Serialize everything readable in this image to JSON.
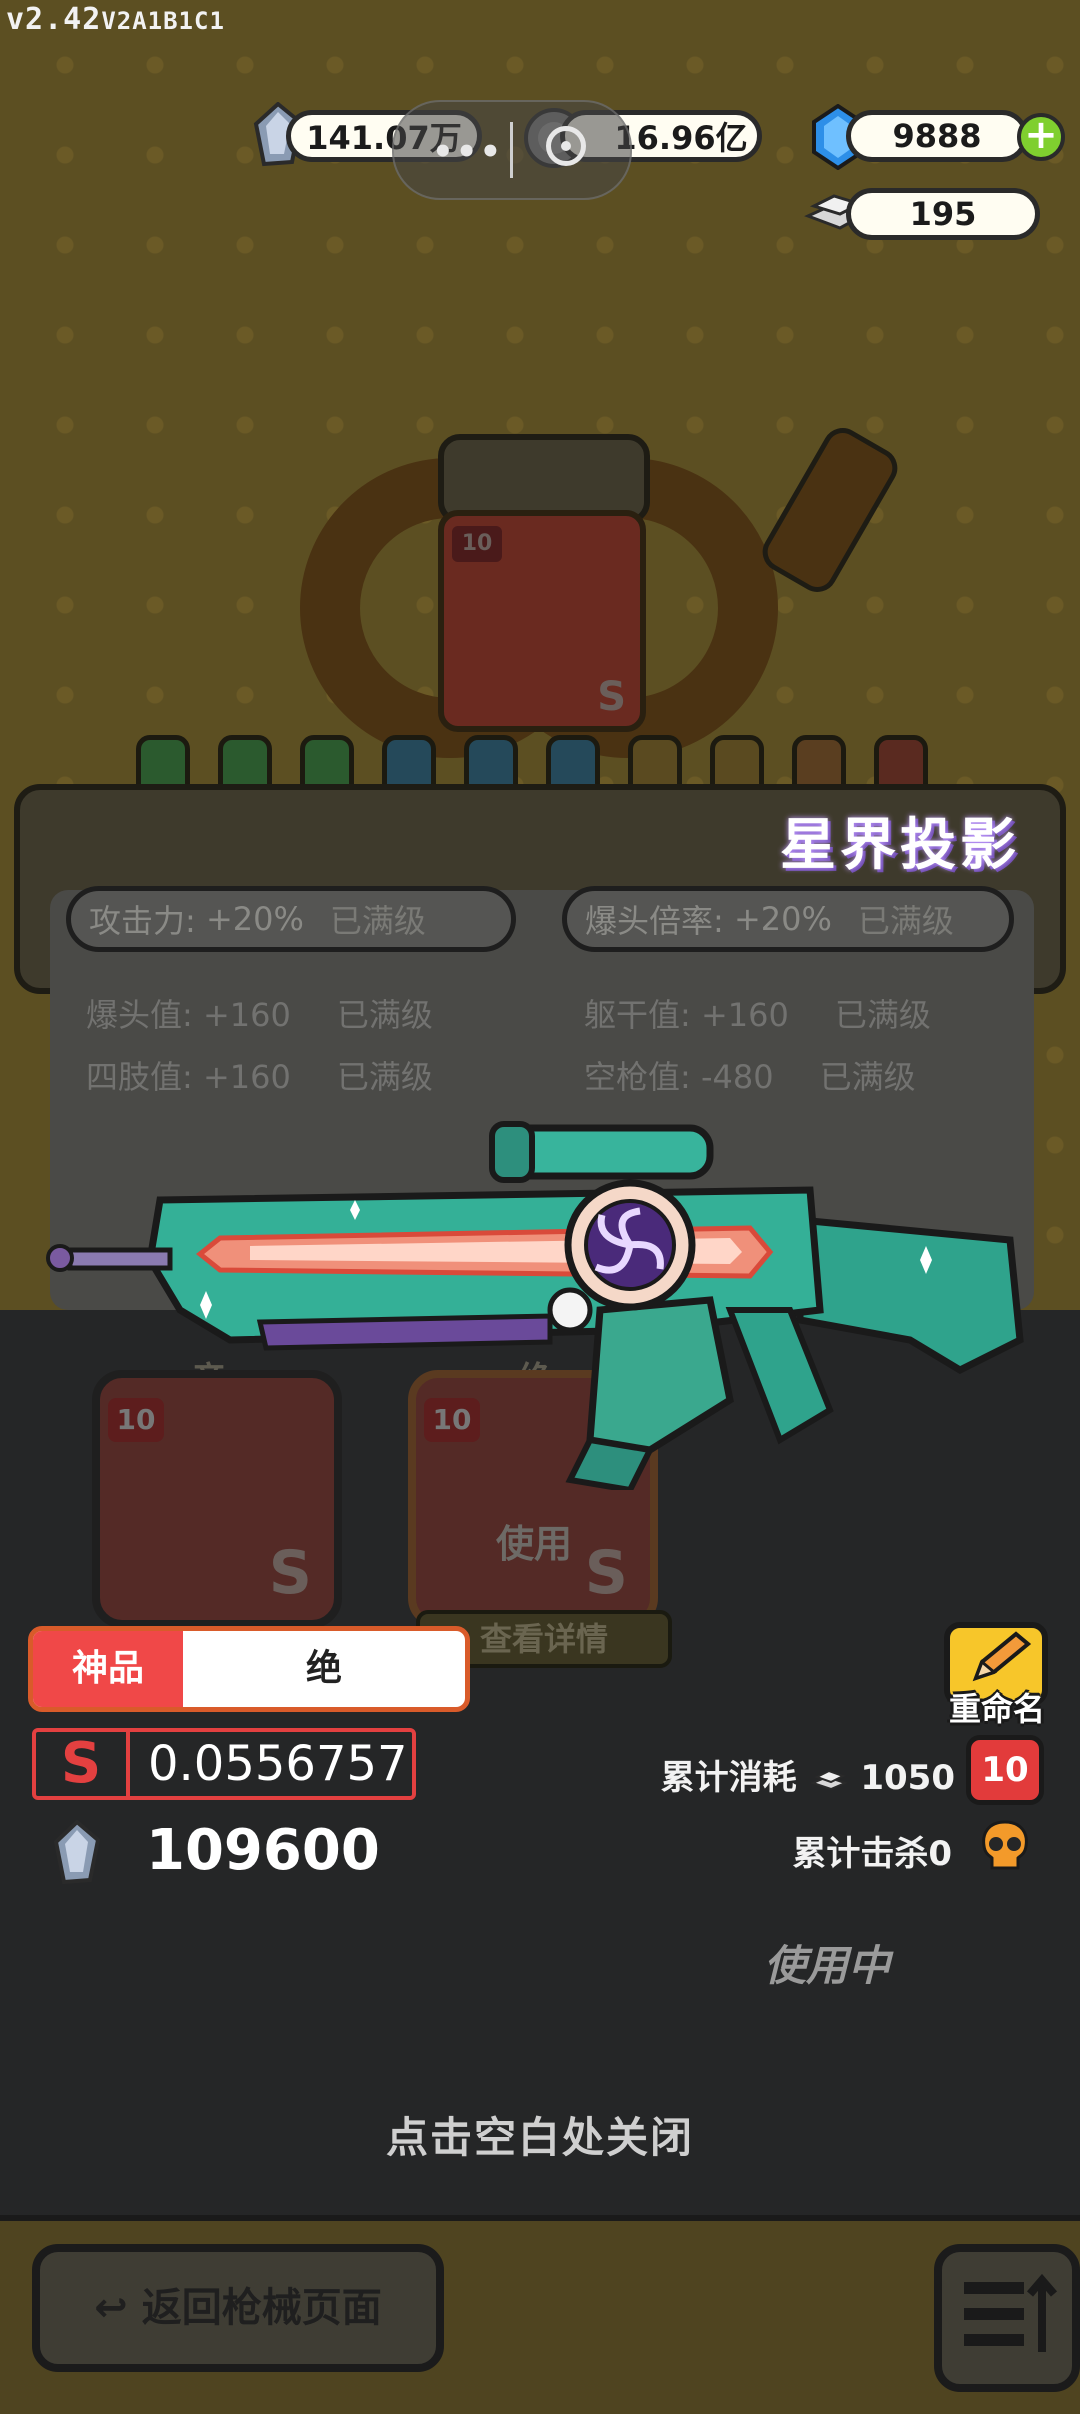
{
  "version": {
    "main": "v2.42",
    "build": "V2A1B1C1"
  },
  "currencies": {
    "crystal": "141.07万",
    "coin": "16.96亿",
    "diamond": "9888",
    "silver": "195"
  },
  "capsule": {
    "menu": "•••"
  },
  "gun": {
    "name": "星界投影",
    "quality_tag": "神品",
    "quality_value": "绝",
    "rank": "S",
    "rate": "0.0556757",
    "price": "109600",
    "in_use": "使用中"
  },
  "stats": {
    "attack": {
      "label": "攻击力:",
      "value": "+20%",
      "status": "已满级"
    },
    "headshot_rate": {
      "label": "爆头倍率:",
      "value": "+20%",
      "status": "已满级"
    },
    "rows": [
      {
        "label": "爆头值:",
        "value": "+160",
        "status": "已满级"
      },
      {
        "label": "躯干值:",
        "value": "+160",
        "status": "已满级"
      },
      {
        "label": "四肢值:",
        "value": "+160",
        "status": "已满级"
      },
      {
        "label": "空枪值:",
        "value": "-480",
        "status": "已满级"
      }
    ]
  },
  "cards": [
    {
      "tag": "帝",
      "level": "10",
      "rank": "S"
    },
    {
      "tag": "绝",
      "level": "10",
      "rank": "S",
      "used": "使用"
    }
  ],
  "card_level_badge": "10",
  "view_details": "查看详情",
  "rename": "重命名",
  "consumption": {
    "label": "累计消耗",
    "value": "1050",
    "level": "10"
  },
  "kills": {
    "label": "累计击杀",
    "value": "0"
  },
  "close_hint": "点击空白处关闭",
  "back_button": "返回枪械页面",
  "colors": {
    "quality_red": "#f04848",
    "accent_orange": "#d95b2a",
    "rank_red": "#e34040",
    "gun_teal": "#2fa38c"
  }
}
